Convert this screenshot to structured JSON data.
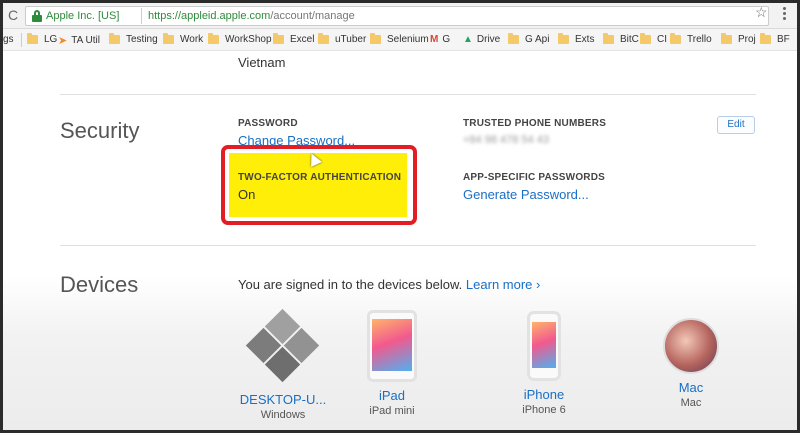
{
  "browser": {
    "site_name": "Apple Inc. [US]",
    "url_scheme_host": "https://appleid.apple.com",
    "url_path": "/account/manage"
  },
  "bookmarks": [
    "gs",
    "LG",
    "TA Util",
    "Testing",
    "Work",
    "WorkShop",
    "Excel",
    "uTuber",
    "Selenium",
    "G",
    "Drive",
    "G Api",
    "Exts",
    "BitC",
    "CI",
    "Trello",
    "Proj",
    "BF"
  ],
  "account": {
    "country": "Vietnam"
  },
  "security": {
    "title": "Security",
    "password_label": "PASSWORD",
    "change_password": "Change Password...",
    "trusted_label": "TRUSTED PHONE NUMBERS",
    "trusted_value": "+84 98 478 54 43",
    "edit_label": "Edit",
    "tfa_label": "TWO-FACTOR AUTHENTICATION",
    "tfa_value": "On",
    "app_label": "APP-SPECIFIC PASSWORDS",
    "generate_password": "Generate Password..."
  },
  "devices": {
    "title": "Devices",
    "signed_in_text": "You are signed in to the devices below.",
    "learn_more": "Learn more",
    "items": [
      {
        "name": "DESKTOP-U...",
        "model": "Windows"
      },
      {
        "name": "iPad",
        "model": "iPad mini"
      },
      {
        "name": "iPhone",
        "model": "iPhone 6"
      },
      {
        "name": "Mac",
        "model": "Mac"
      }
    ]
  },
  "colors": {
    "link": "#1a6fc4",
    "highlight": "#ffef08",
    "outline": "#e31d24",
    "secure_green": "#2e8b3c"
  }
}
